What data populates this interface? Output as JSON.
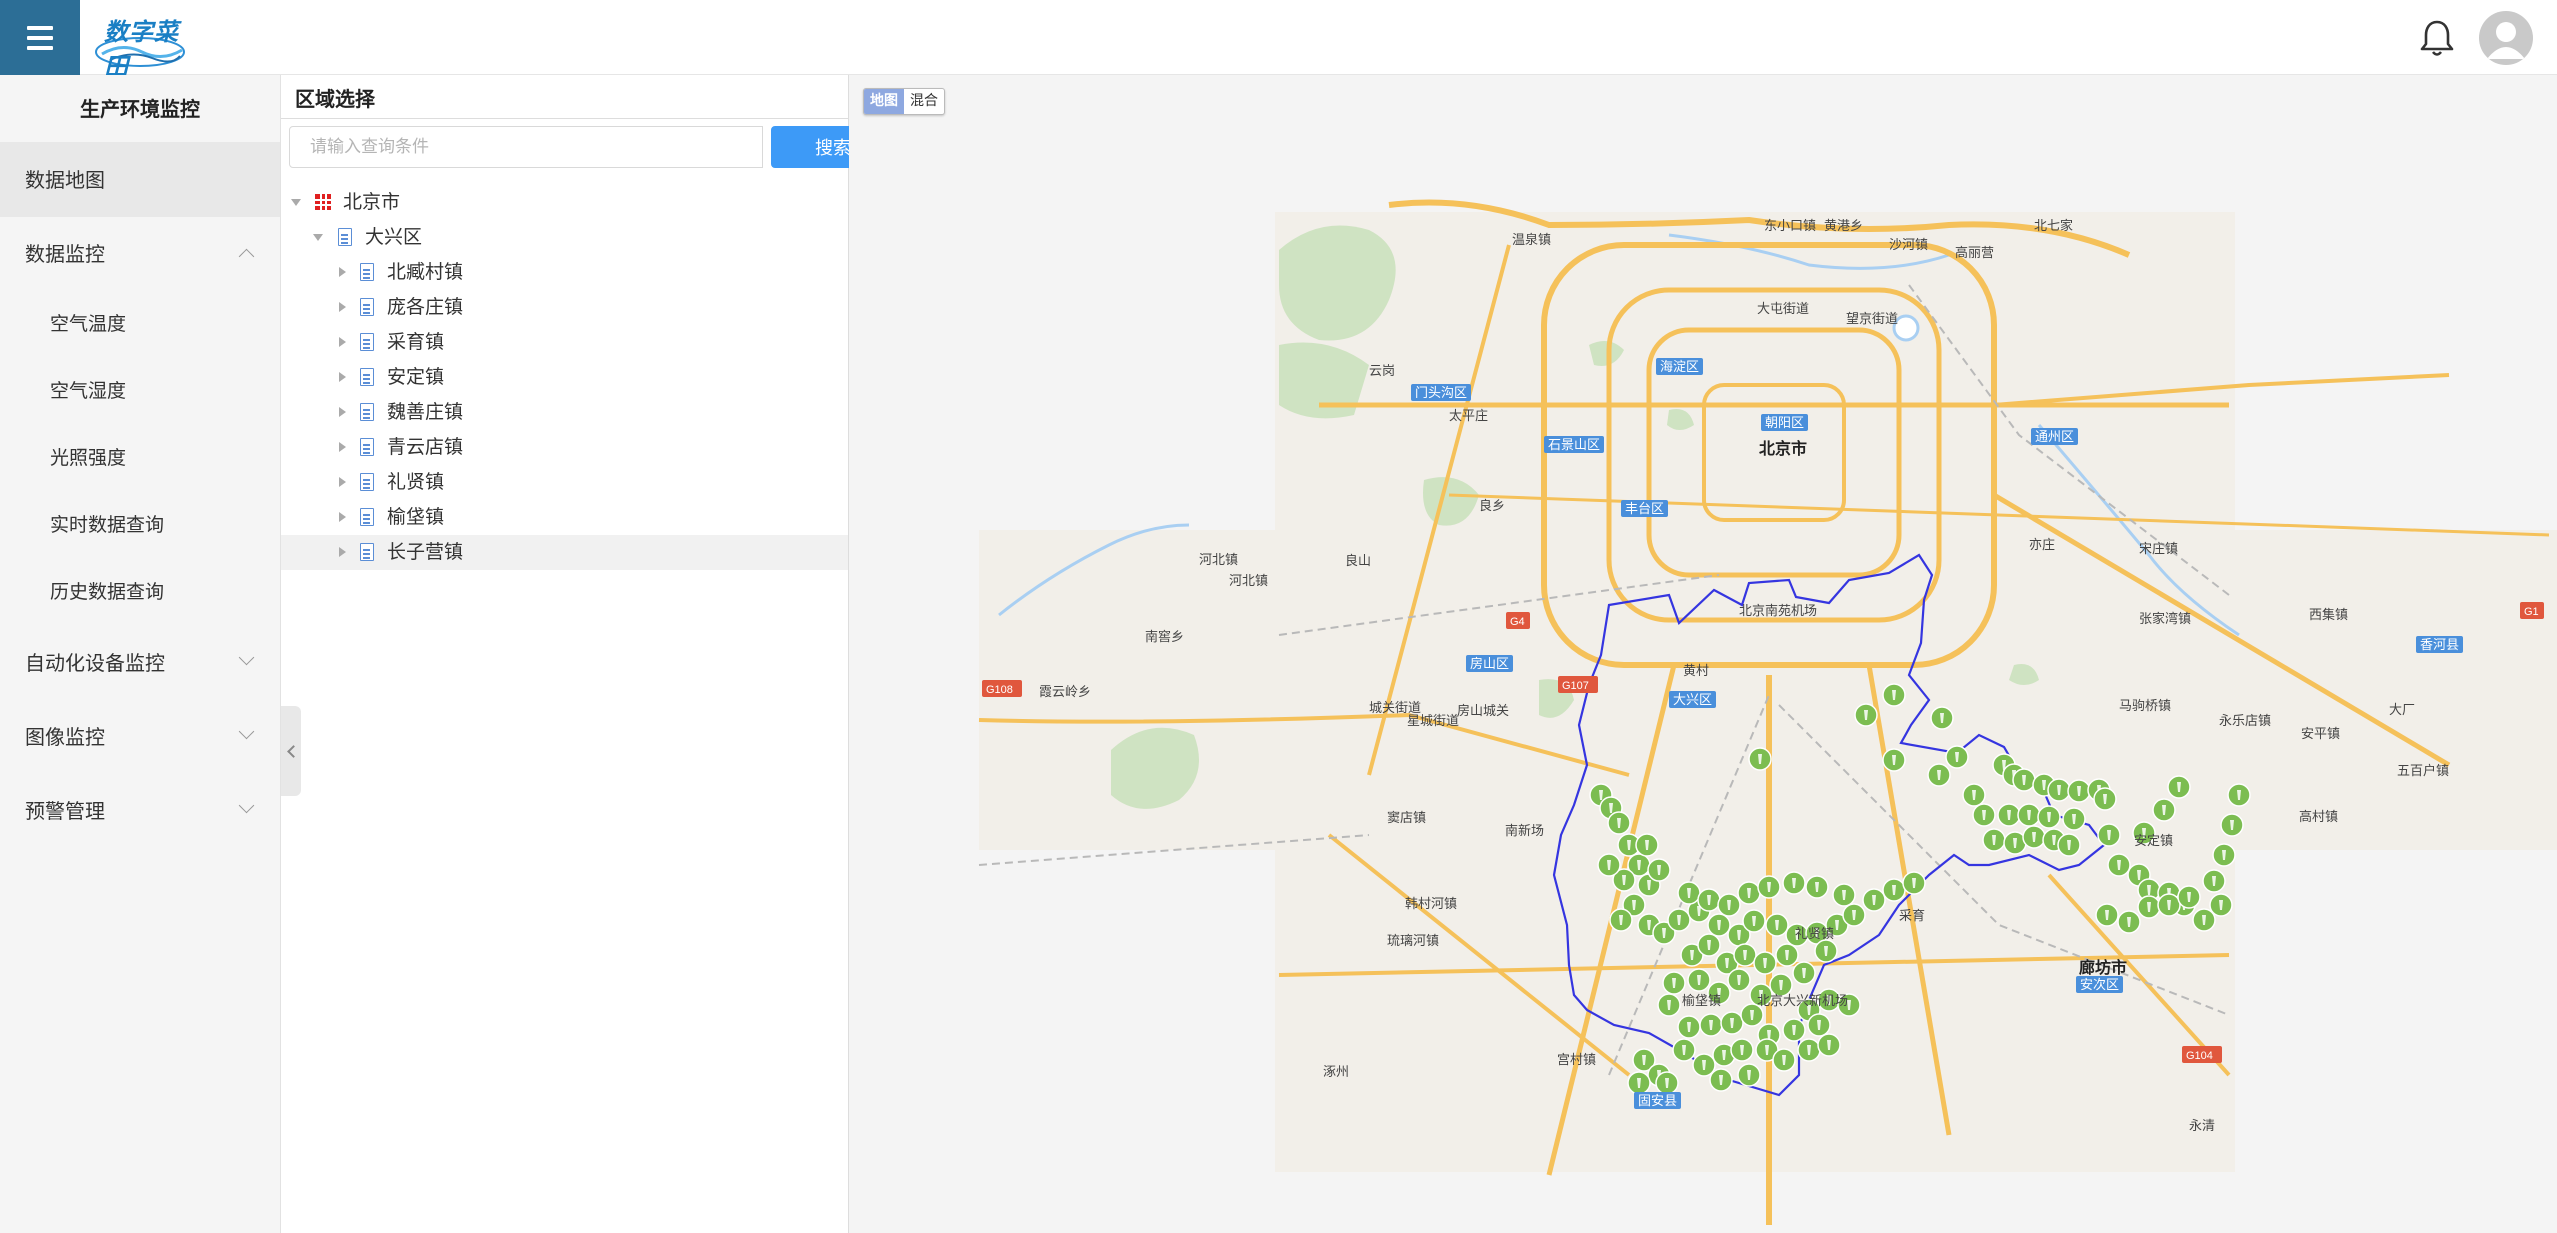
{
  "header": {
    "logo_text": "数字菜田",
    "menu_icon": "hamburger-icon",
    "bell_icon": "bell-icon",
    "avatar_icon": "user-avatar-icon",
    "menu_bg": "#2c6e96"
  },
  "sidebar": {
    "title": "生产环境监控",
    "items": [
      {
        "label": "数据地图",
        "active": true
      },
      {
        "label": "数据监控",
        "expanded": true,
        "children": [
          "空气温度",
          "空气湿度",
          "光照强度",
          "实时数据查询",
          "历史数据查询"
        ]
      },
      {
        "label": "自动化设备监控",
        "expanded": false
      },
      {
        "label": "图像监控",
        "expanded": false
      },
      {
        "label": "预警管理",
        "expanded": false
      }
    ]
  },
  "region": {
    "title": "区域选择",
    "search_placeholder": "请输入查询条件",
    "search_button": "搜索",
    "tree": {
      "root": "北京市",
      "district": "大兴区",
      "towns": [
        "北臧村镇",
        "庞各庄镇",
        "采育镇",
        "安定镇",
        "魏善庄镇",
        "青云店镇",
        "礼贤镇",
        "榆垡镇",
        "长子营镇"
      ],
      "selected_town": "长子营镇"
    }
  },
  "map": {
    "toggle": [
      "地图",
      "混合"
    ],
    "active_toggle": "地图",
    "labels": {
      "beijing": "北京市",
      "langfang": "廊坊市",
      "daxing": "大兴区",
      "haidian": "海淀区",
      "chaoyang": "朝阳区",
      "tongzhou": "通州区",
      "shijingshan": "石景山区",
      "fengtai": "丰台区",
      "mentougou": "门头沟区",
      "fangshan": "房山区",
      "anci": "安次区",
      "xianghe": "香河县",
      "guan": "固安县",
      "wenquan": "温泉镇",
      "dongxiaokou": "东小口镇",
      "huangqiao": "黄港乡",
      "yunlin": "云岗",
      "datun": "大屯街道",
      "wangjing": "望京街道",
      "shahe": "沙河镇",
      "beiqijia": "北七家",
      "liangxiang": "良乡",
      "yizhuang": "亦庄",
      "majuqiao": "马驹桥镇",
      "yufa": "榆垡镇",
      "lixian": "礼贤镇",
      "caiyu": "采育",
      "ancun": "安定镇",
      "hedong": "河北镇",
      "nanjiao": "南窖乡",
      "xiawan": "霞云岭乡",
      "xingcheng": "星城街道",
      "douDian": "窦店镇",
      "liulihe": "琉璃河镇",
      "hanjiachuan": "韩村河镇",
      "zhuozhou": "涿州",
      "gu_an_town": "宫村镇",
      "nanxin": "南新场",
      "beijingnan": "北京南苑机场",
      "daxing_airport": "北京大兴新机场",
      "g108": "G108",
      "g107": "G107",
      "g104": "G104",
      "g4": "G4",
      "g1": "G1",
      "chenying": "城关街道",
      "zhangjiawan": "张家湾镇",
      "songzhuang": "宋庄镇",
      "gaoliying": "高丽营",
      "huangcun": "黄村",
      "xiji": "西集镇",
      "yongledian": "永乐店镇",
      "dachang": "大厂",
      "anping": "安平镇",
      "wuliqiao": "五百户镇",
      "gaocun": "高村镇",
      "taiping": "太平庄",
      "yongqing": "永清",
      "liangshan": "良山",
      "hebei_town": "河北镇",
      "fangshan_city": "房山城关"
    },
    "district_color": "#3535e0",
    "marker_color": "#7cbd51",
    "road_color": "#f5c15a"
  }
}
